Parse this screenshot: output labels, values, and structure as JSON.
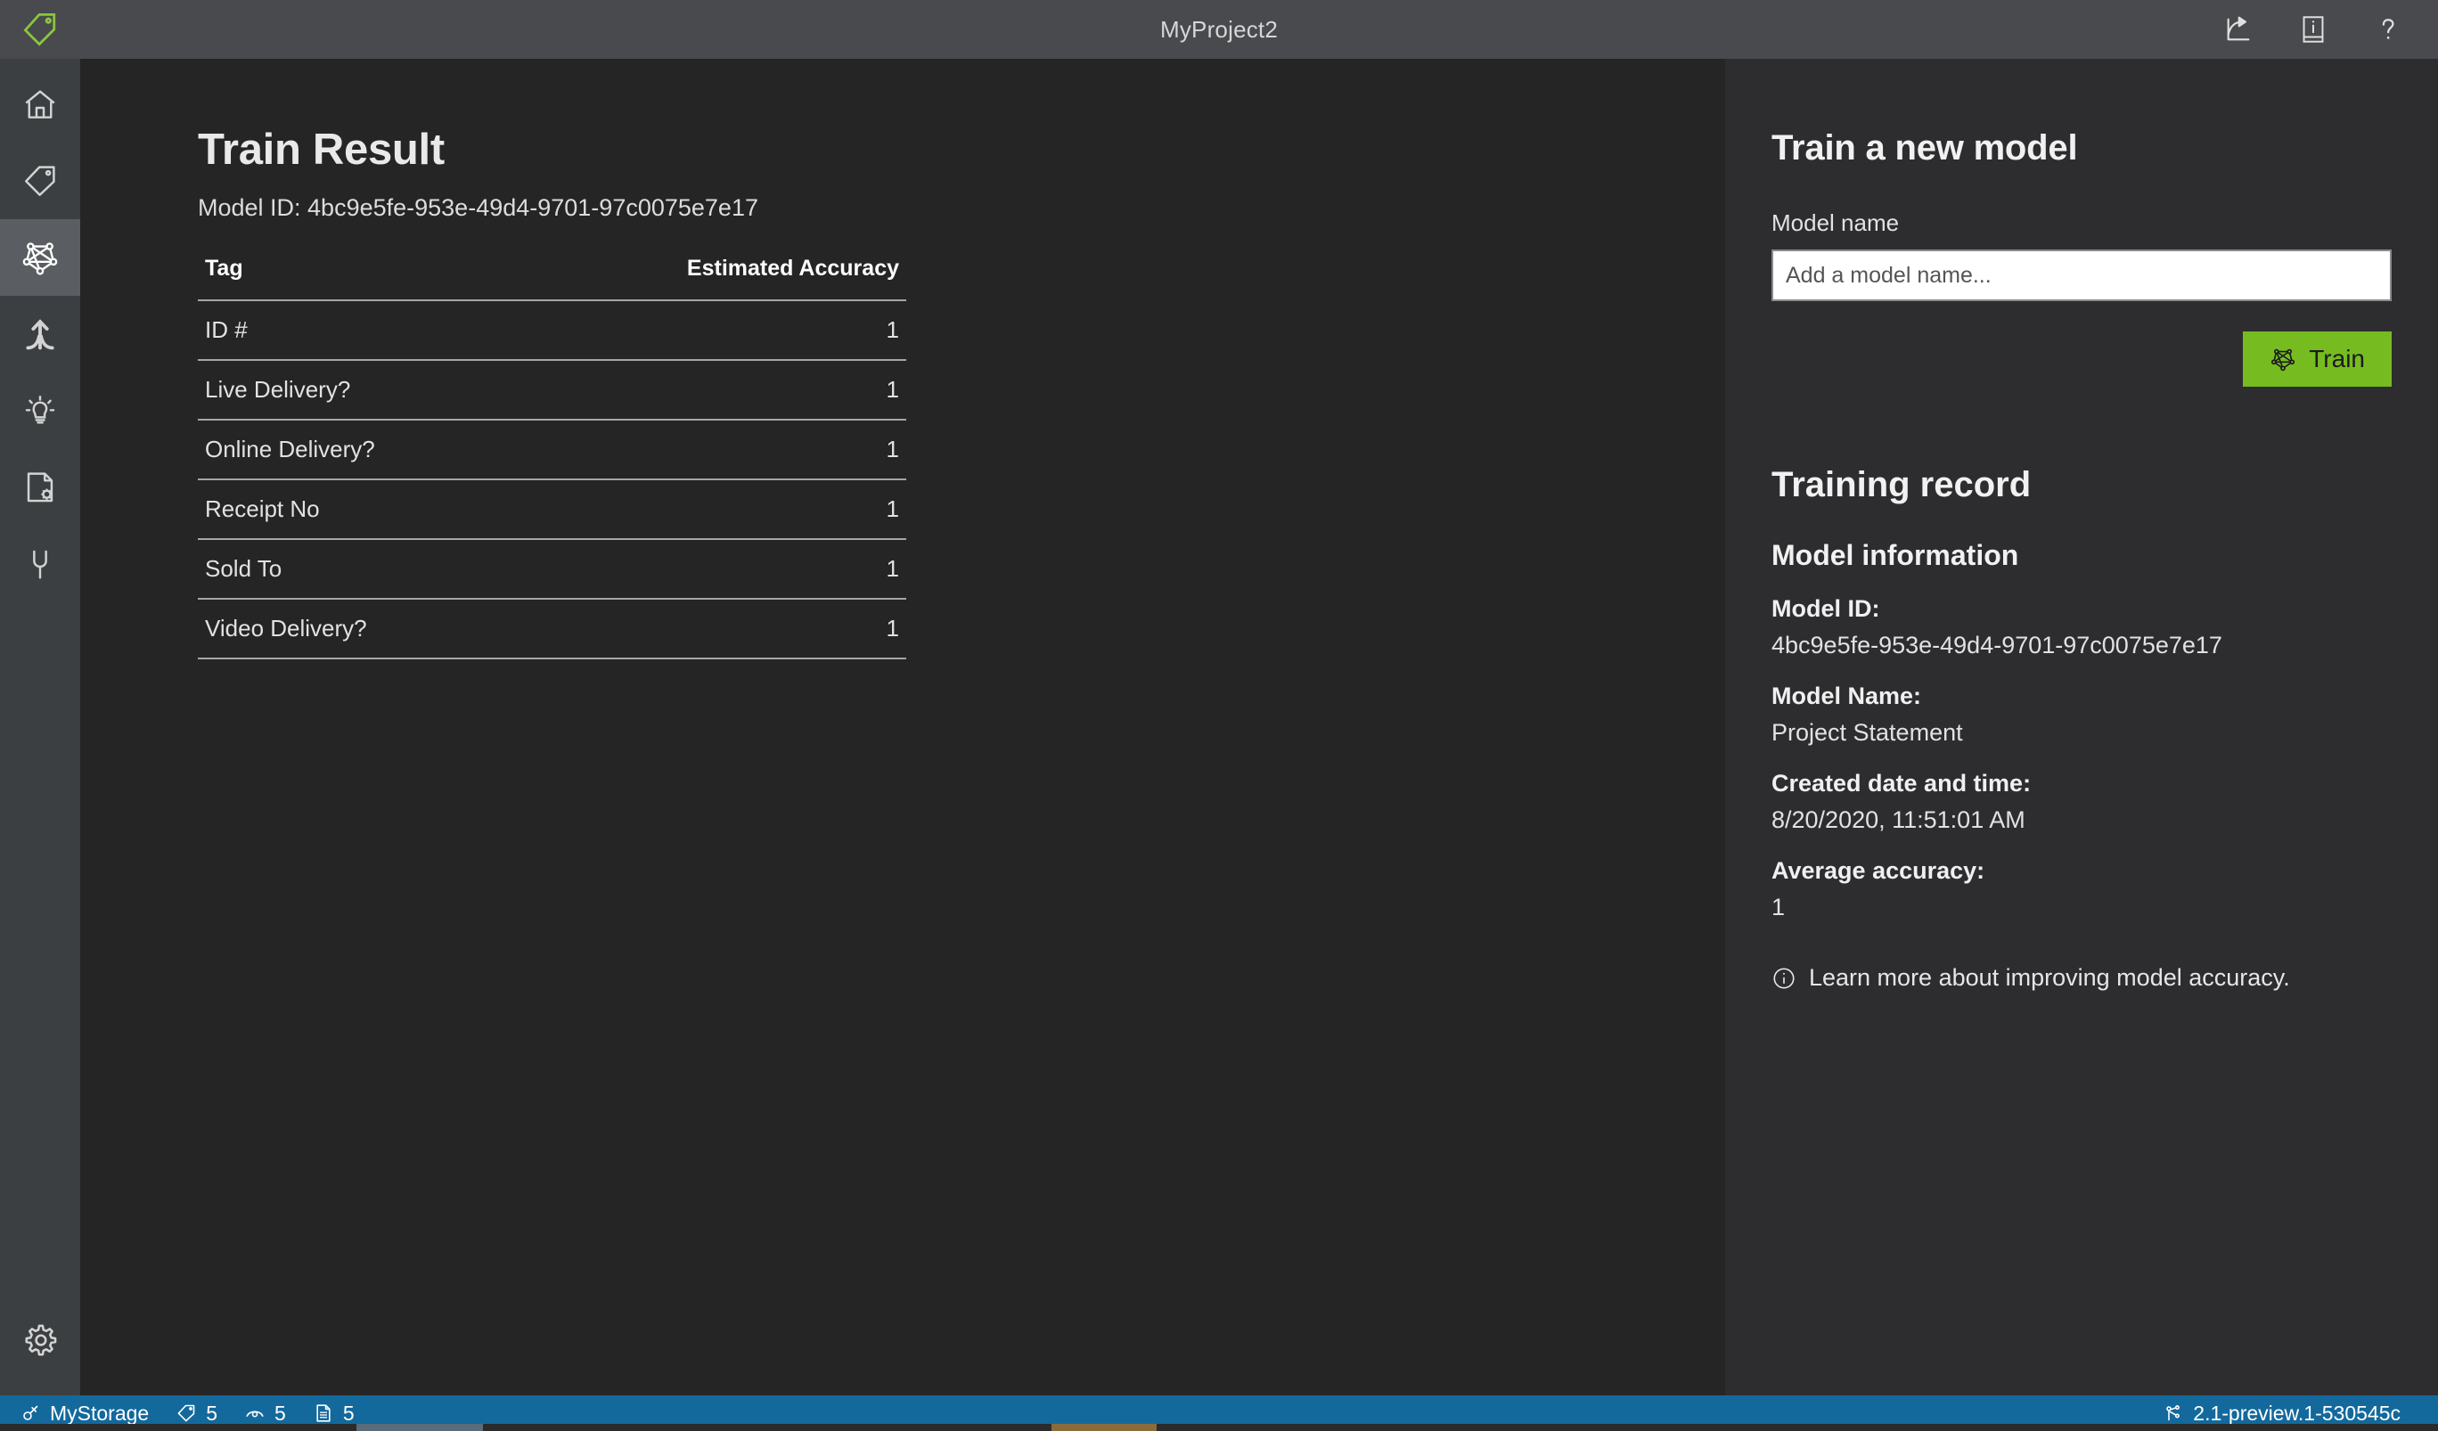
{
  "titlebar": {
    "logo_icon": "tag-logo-icon",
    "title": "MyProject2",
    "actions": [
      {
        "icon": "share-icon",
        "name": "share-button"
      },
      {
        "icon": "info-book-icon",
        "name": "info-button"
      },
      {
        "icon": "help-icon",
        "name": "help-button"
      }
    ]
  },
  "rail": {
    "items": [
      {
        "icon": "home-icon",
        "name": "sidebar-item-home",
        "selected": false
      },
      {
        "icon": "tag-icon",
        "name": "sidebar-item-tag",
        "selected": false
      },
      {
        "icon": "model-network-icon",
        "name": "sidebar-item-train",
        "selected": true
      },
      {
        "icon": "merge-branch-icon",
        "name": "sidebar-item-compose",
        "selected": false
      },
      {
        "icon": "lightbulb-icon",
        "name": "sidebar-item-predict",
        "selected": false
      },
      {
        "icon": "document-settings-icon",
        "name": "sidebar-item-document-settings",
        "selected": false
      },
      {
        "icon": "plug-icon",
        "name": "sidebar-item-connections",
        "selected": false
      }
    ],
    "settings": {
      "icon": "gear-icon",
      "name": "sidebar-item-settings"
    }
  },
  "main": {
    "title": "Train Result",
    "model_id_line": "Model ID: 4bc9e5fe-953e-49d4-9701-97c0075e7e17",
    "table": {
      "columns": [
        "Tag",
        "Estimated Accuracy"
      ],
      "rows": [
        {
          "tag": "ID #",
          "accuracy": "1"
        },
        {
          "tag": "Live Delivery?",
          "accuracy": "1"
        },
        {
          "tag": "Online Delivery?",
          "accuracy": "1"
        },
        {
          "tag": "Receipt No",
          "accuracy": "1"
        },
        {
          "tag": "Sold To",
          "accuracy": "1"
        },
        {
          "tag": "Video Delivery?",
          "accuracy": "1"
        }
      ]
    }
  },
  "panel": {
    "train_heading": "Train a new model",
    "model_name_label": "Model name",
    "model_name_value": "",
    "model_name_placeholder": "Add a model name...",
    "train_button_label": "Train",
    "train_button_icon": "model-network-icon",
    "train_button_color": "#76bc21",
    "training_record_heading": "Training record",
    "model_information_heading": "Model information",
    "fields": [
      {
        "key": "Model ID:",
        "value": "4bc9e5fe-953e-49d4-9701-97c0075e7e17"
      },
      {
        "key": "Model Name:",
        "value": "Project Statement"
      },
      {
        "key": "Created date and time:",
        "value": "8/20/2020, 11:51:01 AM"
      },
      {
        "key": "Average accuracy:",
        "value": "1"
      }
    ],
    "learn_more_icon": "info-circle-icon",
    "learn_more_text": "Learn more about improving model accuracy."
  },
  "statusbar": {
    "background": "#13699c",
    "items": [
      {
        "icon": "plug-icon",
        "label": "MyStorage",
        "name": "status-storage"
      },
      {
        "icon": "tag-icon",
        "label": "5",
        "name": "status-tag-count"
      },
      {
        "icon": "eye-icon",
        "label": "5",
        "name": "status-view-count"
      },
      {
        "icon": "document-icon",
        "label": "5",
        "name": "status-document-count"
      }
    ],
    "version_icon": "branch-icon",
    "version": "2.1-preview.1-530545c"
  }
}
